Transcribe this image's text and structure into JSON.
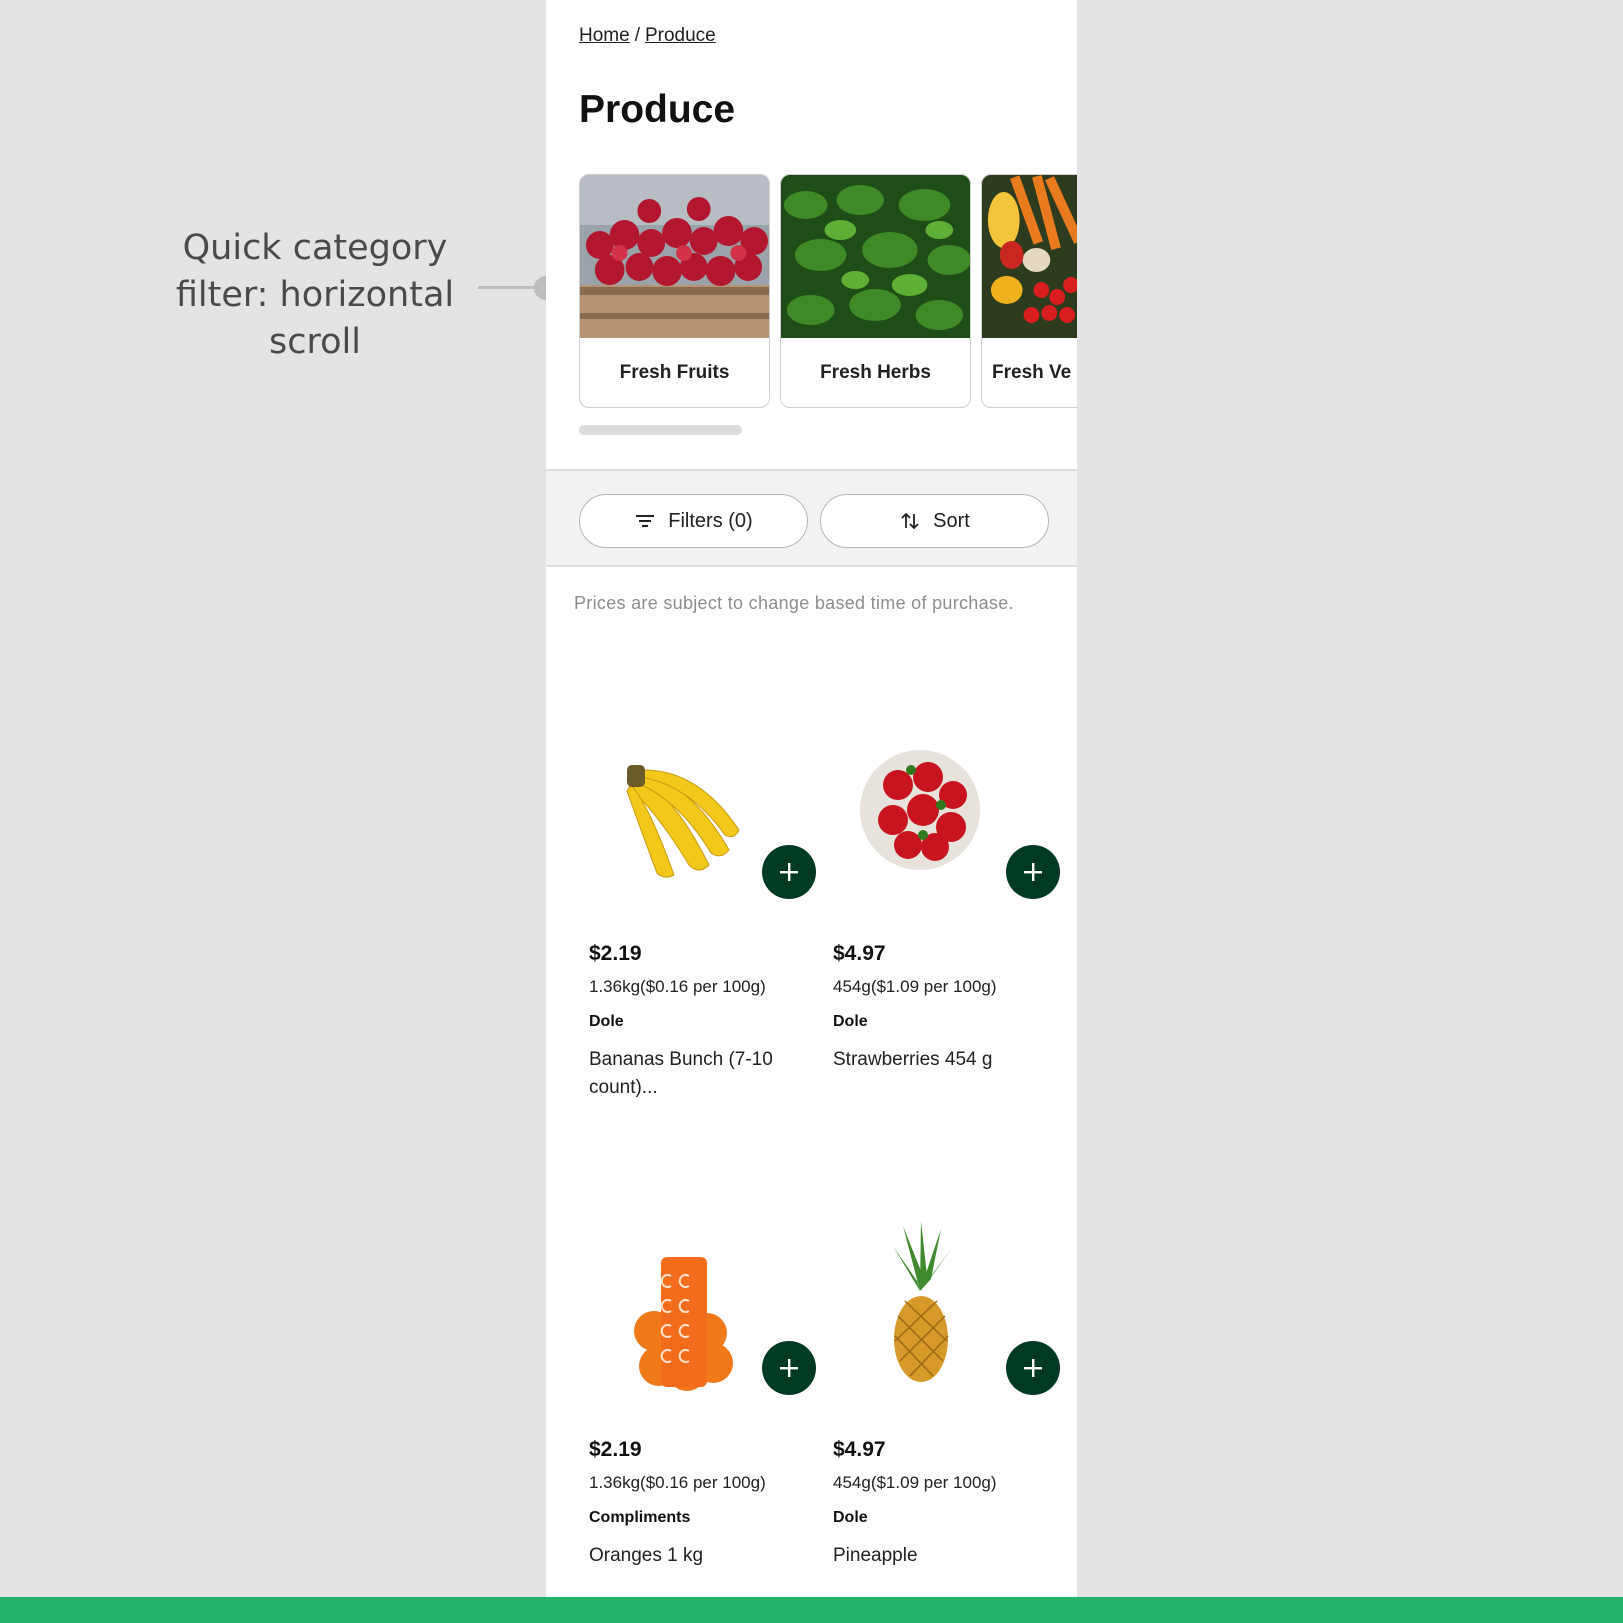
{
  "annotation": {
    "text": "Quick category filter: horizontal scroll"
  },
  "breadcrumb": {
    "home": "Home",
    "separator": "/",
    "current": "Produce"
  },
  "page_title": "Produce",
  "categories": [
    {
      "label": "Fresh Fruits",
      "icon": "strawberries-crate-photo"
    },
    {
      "label": "Fresh Herbs",
      "icon": "basil-herbs-photo"
    },
    {
      "label": "Fresh Ve",
      "icon": "mixed-vegetables-photo"
    }
  ],
  "toolbar": {
    "filters_label": "Filters (0)",
    "sort_label": "Sort"
  },
  "notice": "Prices are subject to change based time of purchase.",
  "products": [
    {
      "price": "$2.19",
      "unit": "1.36kg($0.16 per 100g)",
      "brand": "Dole",
      "name": "Bananas Bunch (7-10 count)...",
      "icon": "banana-photo"
    },
    {
      "price": "$4.97",
      "unit": "454g($1.09 per 100g)",
      "brand": "Dole",
      "name": "Strawberries 454 g",
      "icon": "strawberry-bowl-photo"
    },
    {
      "price": "$2.19",
      "unit": "1.36kg($0.16 per 100g)",
      "brand": "Compliments",
      "name": "Oranges 1 kg",
      "icon": "orange-bag-photo"
    },
    {
      "price": "$4.97",
      "unit": "454g($1.09 per 100g)",
      "brand": "Dole",
      "name": "Pineapple",
      "icon": "pineapple-photo"
    }
  ],
  "colors": {
    "add_button": "#003a23",
    "bottom_bar": "#24b36b",
    "canvas": "#e4e4e4"
  }
}
